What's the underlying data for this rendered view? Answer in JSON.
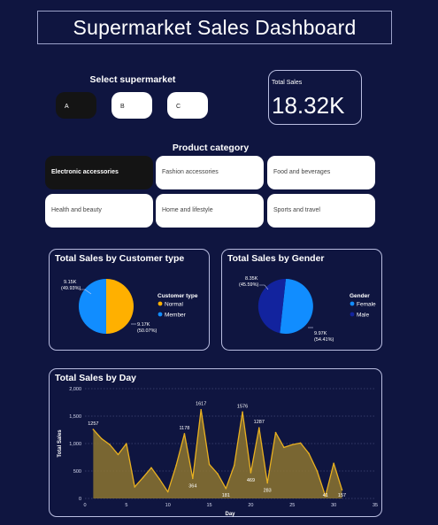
{
  "dashboard": {
    "title": "Supermarket Sales Dashboard"
  },
  "supermarket": {
    "label": "Select supermarket",
    "options": [
      "A",
      "B",
      "C"
    ],
    "selected": "A"
  },
  "total_sales": {
    "label": "Total Sales",
    "value": "18.32K"
  },
  "category": {
    "label": "Product category",
    "options": [
      "Electronic accessories",
      "Fashion accessories",
      "Food and beverages",
      "Health and beauty",
      "Home and lifestyle",
      "Sports and travel"
    ],
    "selected": "Electronic accessories"
  },
  "colors": {
    "background": "#0f1540",
    "orange": "#ffb000",
    "blue": "#118dff",
    "darkblue": "#12239e",
    "line": "#e8b020"
  },
  "customer_chart": {
    "title": "Total Sales by Customer type",
    "legend_title": "Customer type",
    "legend": [
      "Normal",
      "Member"
    ],
    "label_member_value": "9.15K",
    "label_member_pct": "(49.93%)",
    "label_normal_value": "9.17K",
    "label_normal_pct": "(50.07%)"
  },
  "gender_chart": {
    "title": "Total Sales by Gender",
    "legend_title": "Gender",
    "legend": [
      "Female",
      "Male"
    ],
    "label_male_value": "8.35K",
    "label_male_pct": "(45.59%)",
    "label_female_value": "9.97K",
    "label_female_pct": "(54.41%)"
  },
  "day_chart": {
    "title": "Total Sales by Day"
  },
  "chart_data": [
    {
      "type": "pie",
      "title": "Total Sales by Customer type",
      "legend_title": "Customer type",
      "labels": [
        "Normal",
        "Member"
      ],
      "values": [
        9170,
        9150
      ],
      "percent": [
        50.07,
        49.93
      ],
      "colors": [
        "#ffb000",
        "#118dff"
      ],
      "legend_position": "right"
    },
    {
      "type": "pie",
      "title": "Total Sales by Gender",
      "legend_title": "Gender",
      "labels": [
        "Female",
        "Male"
      ],
      "values": [
        9970,
        8350
      ],
      "percent": [
        54.41,
        45.59
      ],
      "colors": [
        "#118dff",
        "#12239e"
      ],
      "legend_position": "right"
    },
    {
      "type": "area",
      "title": "Total Sales by Day",
      "xlabel": "Day",
      "ylabel": "Total Sales",
      "xlim": [
        0,
        35
      ],
      "ylim": [
        0,
        2000
      ],
      "xticks": [
        0,
        5,
        10,
        15,
        20,
        25,
        30,
        35
      ],
      "yticks": [
        "0",
        "500",
        "1,000",
        "1,500",
        "2,000"
      ],
      "grid": true,
      "x": [
        1,
        2,
        3,
        4,
        5,
        6,
        7,
        8,
        9,
        10,
        11,
        12,
        13,
        14,
        15,
        16,
        17,
        18,
        19,
        20,
        21,
        22,
        23,
        24,
        25,
        26,
        27,
        28,
        29,
        30,
        31
      ],
      "values": [
        1257,
        1090,
        980,
        800,
        1000,
        210,
        380,
        560,
        350,
        120,
        600,
        1178,
        364,
        1617,
        620,
        450,
        181,
        600,
        1576,
        469,
        1287,
        283,
        1200,
        930,
        980,
        1010,
        820,
        500,
        40,
        640,
        157
      ],
      "data_labels": [
        {
          "x": 1,
          "text": "1257"
        },
        {
          "x": 12,
          "text": "1178"
        },
        {
          "x": 13,
          "text": "364"
        },
        {
          "x": 14,
          "text": "1617"
        },
        {
          "x": 17,
          "text": "181"
        },
        {
          "x": 19,
          "text": "1576"
        },
        {
          "x": 20,
          "text": "469"
        },
        {
          "x": 21,
          "text": "1287"
        },
        {
          "x": 22,
          "text": "283"
        },
        {
          "x": 29,
          "text": "41"
        },
        {
          "x": 31,
          "text": "157"
        }
      ]
    }
  ]
}
